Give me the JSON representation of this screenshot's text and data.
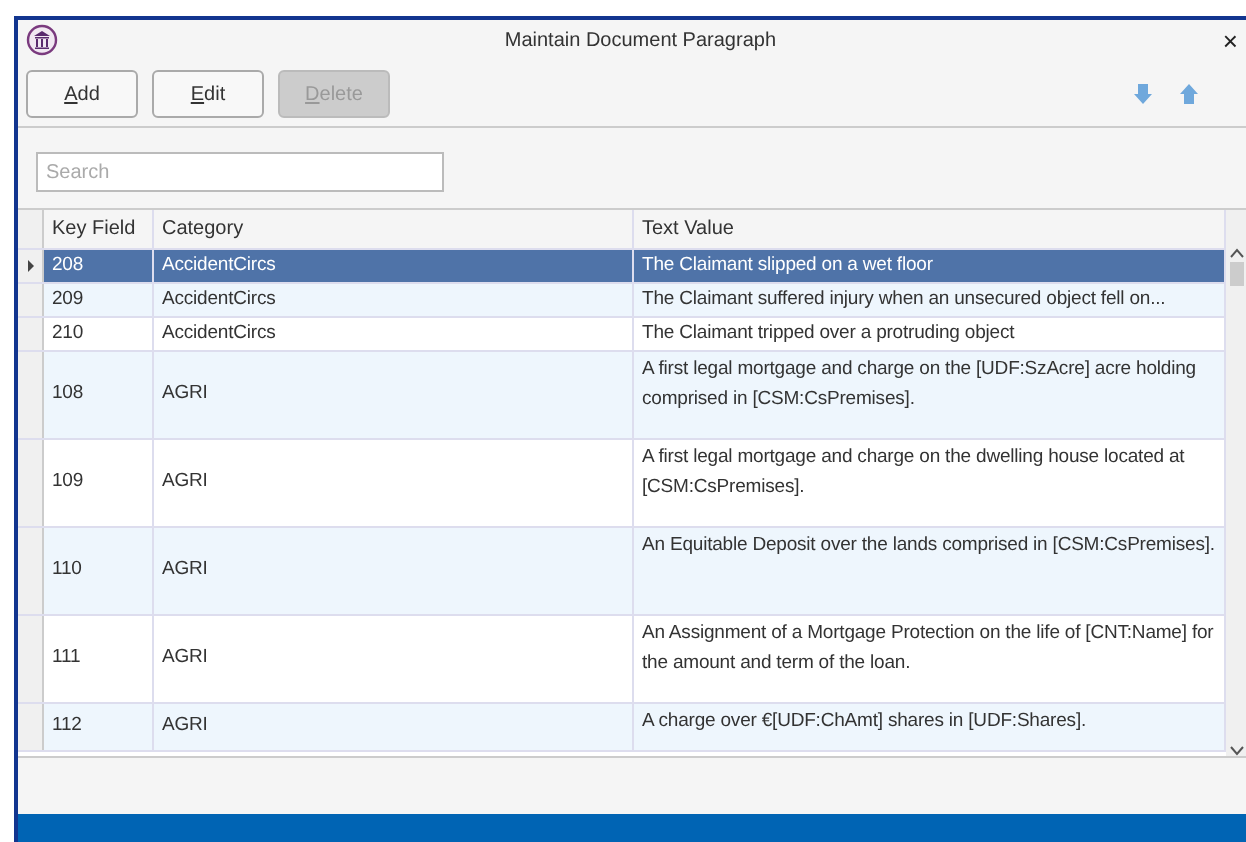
{
  "window": {
    "title": "Maintain Document Paragraph",
    "close": "×"
  },
  "toolbar": {
    "buttons": [
      {
        "label": "Add",
        "disabled": false
      },
      {
        "label": "Edit",
        "disabled": false
      },
      {
        "label": "Delete",
        "disabled": true
      }
    ]
  },
  "search": {
    "placeholder": "Search"
  },
  "table": {
    "columns": [
      "Key Field",
      "Category",
      "Text Value"
    ],
    "rows": [
      {
        "key": "208",
        "category": "AccidentCircs",
        "text": "The Claimant slipped on a wet floor",
        "selected": true,
        "tall": false
      },
      {
        "key": "209",
        "category": "AccidentCircs",
        "text": "The Claimant suffered injury when an unsecured object fell on...",
        "selected": false,
        "tall": false
      },
      {
        "key": "210",
        "category": "AccidentCircs",
        "text": "The Claimant tripped over a protruding object",
        "selected": false,
        "tall": false
      },
      {
        "key": "108",
        "category": "AGRI",
        "text": "A first legal mortgage and charge on the [UDF:SzAcre] acre holding comprised in [CSM:CsPremises].",
        "selected": false,
        "tall": true
      },
      {
        "key": "109",
        "category": "AGRI",
        "text": "A first legal mortgage and charge on the dwelling house located at [CSM:CsPremises].",
        "selected": false,
        "tall": true
      },
      {
        "key": "110",
        "category": "AGRI",
        "text": "An Equitable Deposit over the lands comprised in [CSM:CsPremises].",
        "selected": false,
        "tall": true
      },
      {
        "key": "111",
        "category": "AGRI",
        "text": "An Assignment of a Mortgage Protection on the life of [CNT:Name] for the amount and term of the loan.",
        "selected": false,
        "tall": true
      },
      {
        "key": "112",
        "category": "AGRI",
        "text": "A charge over €[UDF:ChAmt] shares in [UDF:Shares].",
        "selected": false,
        "tall": false
      }
    ]
  }
}
